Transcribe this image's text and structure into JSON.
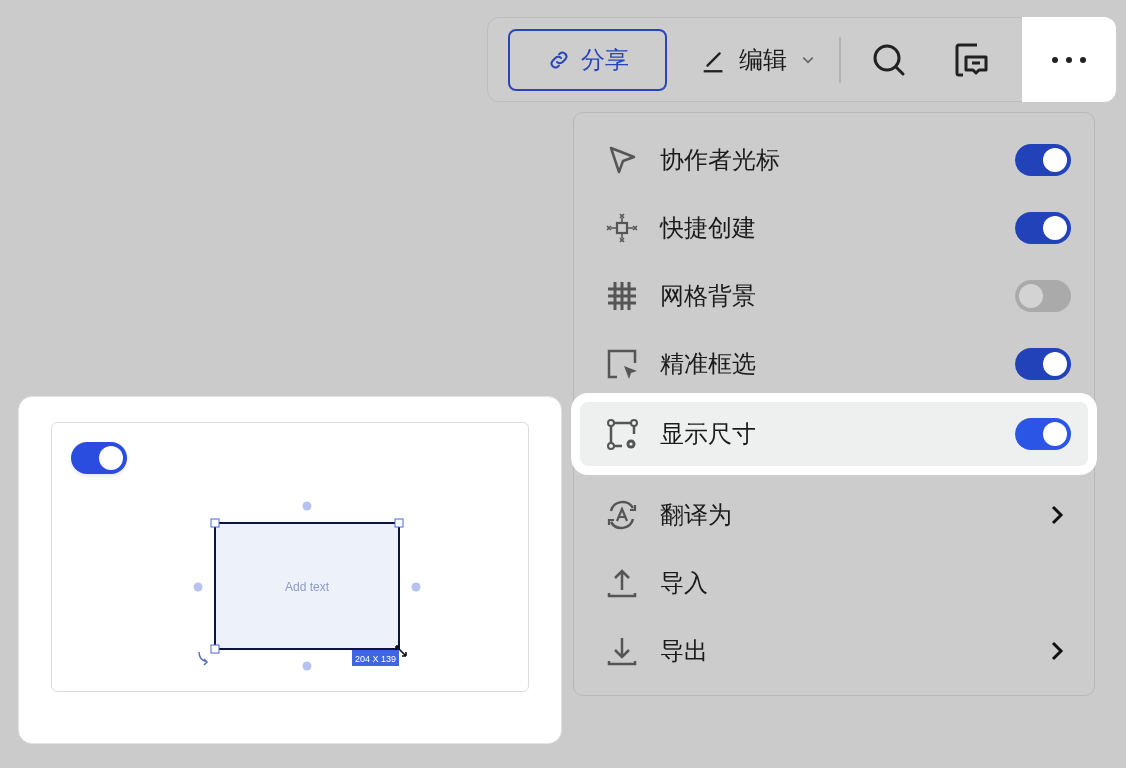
{
  "toolbar": {
    "share_button": "分享",
    "edit_menu": "编辑",
    "more_button": {
      "highlighted": true
    }
  },
  "menu": {
    "items": [
      {
        "kind": "toggle",
        "label": "协作者光标",
        "on": true,
        "highlighted": false
      },
      {
        "kind": "toggle",
        "label": "快捷创建",
        "on": true,
        "highlighted": false
      },
      {
        "kind": "toggle",
        "label": "网格背景",
        "on": false,
        "highlighted": false
      },
      {
        "kind": "toggle",
        "label": "精准框选",
        "on": true,
        "highlighted": false
      },
      {
        "kind": "toggle",
        "label": "显示尺寸",
        "on": true,
        "highlighted": true
      },
      {
        "kind": "submenu",
        "label": "翻译为",
        "highlighted": false
      },
      {
        "kind": "action",
        "label": "导入",
        "highlighted": false
      },
      {
        "kind": "submenu",
        "label": "导出",
        "highlighted": false
      }
    ]
  },
  "preview": {
    "toggle_on": true,
    "shape_text": "Add text",
    "size_label": "204 X 139"
  }
}
